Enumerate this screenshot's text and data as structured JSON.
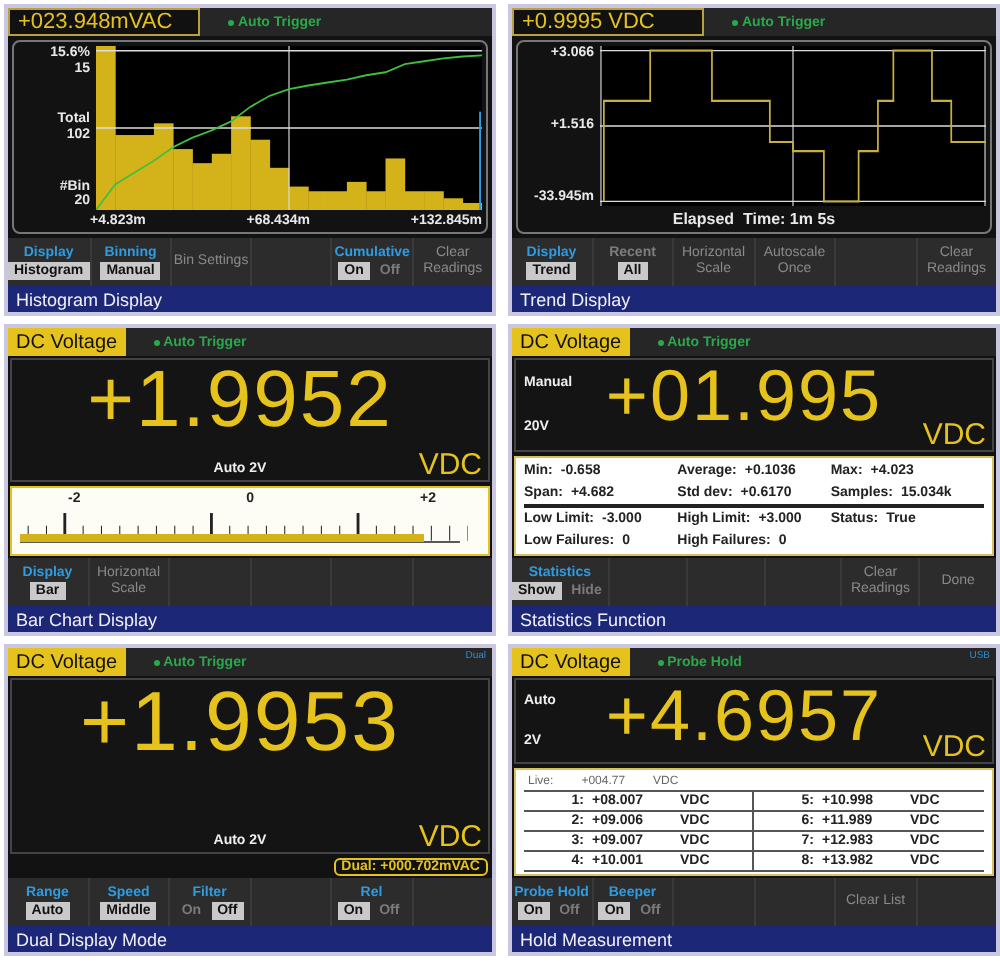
{
  "panels": [
    {
      "kind": "histogram",
      "header": {
        "kind": "reading",
        "label": "+023.948mVAC",
        "status": "Auto Trigger"
      },
      "histogram": {
        "y_labels": [
          [
            "15.6%",
            "15"
          ],
          [
            "Total",
            "102"
          ],
          [
            "#Bin",
            "20"
          ]
        ],
        "x_labels": [
          "+4.823m",
          "+68.434m",
          "+132.845m"
        ]
      },
      "softkeys": [
        {
          "kind": "toggle",
          "title": "Display",
          "disabled": false,
          "options": [
            {
              "label": "Histogram",
              "selected": true
            }
          ]
        },
        {
          "kind": "toggle",
          "title": "Binning",
          "disabled": false,
          "options": [
            {
              "label": "Manual",
              "selected": true
            }
          ]
        },
        {
          "kind": "action",
          "label": "Bin Settings"
        },
        {
          "kind": "empty"
        },
        {
          "kind": "toggle",
          "title": "Cumulative",
          "disabled": false,
          "options": [
            {
              "label": "On",
              "selected": true
            },
            {
              "label": "Off",
              "selected": false
            }
          ]
        },
        {
          "kind": "action",
          "label": "Clear Readings"
        }
      ],
      "caption": "Histogram Display"
    },
    {
      "kind": "trend",
      "header": {
        "kind": "reading",
        "label": "+0.9995 VDC",
        "status": "Auto Trigger"
      },
      "trend": {
        "y_labels": [
          "+3.066",
          "+1.516",
          "-33.945m"
        ],
        "elapsed": "Elapsed  Time: 1m 5s"
      },
      "softkeys": [
        {
          "kind": "toggle",
          "title": "Display",
          "disabled": false,
          "options": [
            {
              "label": "Trend",
              "selected": true
            }
          ]
        },
        {
          "kind": "toggle",
          "title": "Recent",
          "disabled": true,
          "options": [
            {
              "label": "All",
              "selected": true
            }
          ]
        },
        {
          "kind": "action",
          "label": "Horizontal Scale"
        },
        {
          "kind": "action",
          "label": "Autoscale Once"
        },
        {
          "kind": "empty"
        },
        {
          "kind": "action",
          "label": "Clear Readings"
        }
      ],
      "caption": "Trend Display"
    },
    {
      "kind": "bar",
      "header": {
        "kind": "function",
        "label": "DC Voltage",
        "status": "Auto Trigger"
      },
      "reading": {
        "value": "+1.9952",
        "unit": "VDC",
        "range": "Auto 2V"
      },
      "bar": {
        "scale": [
          "-2",
          "0",
          "+2"
        ],
        "level": 0.9
      },
      "softkeys": [
        {
          "kind": "toggle",
          "title": "Display",
          "disabled": false,
          "options": [
            {
              "label": "Bar",
              "selected": true
            }
          ]
        },
        {
          "kind": "action",
          "label": "Horizontal Scale"
        },
        {
          "kind": "empty"
        },
        {
          "kind": "empty"
        },
        {
          "kind": "empty"
        },
        {
          "kind": "empty"
        }
      ],
      "caption": "Bar Chart Display"
    },
    {
      "kind": "statistics",
      "header": {
        "kind": "function",
        "label": "DC Voltage",
        "status": "Auto Trigger"
      },
      "reading": {
        "value": "+01.995",
        "unit": "VDC",
        "range_side": [
          "Manual",
          "20V"
        ]
      },
      "stat_groups": [
        [
          [
            {
              "label": "Min:",
              "value": "-0.658"
            },
            {
              "label": "Average:",
              "value": "+0.1036"
            },
            {
              "label": "Max:",
              "value": "+4.023"
            }
          ],
          [
            {
              "label": "Span:",
              "value": "+4.682"
            },
            {
              "label": "Std dev:",
              "value": "+0.6170"
            },
            {
              "label": "Samples:",
              "value": "15.034k"
            }
          ]
        ],
        [
          [
            {
              "label": "Low Limit:",
              "value": "-3.000"
            },
            {
              "label": "High Limit:",
              "value": "+3.000"
            },
            {
              "label": "Status:",
              "value": "True"
            }
          ],
          [
            {
              "label": "Low Failures:",
              "value": "0"
            },
            {
              "label": "High Failures:",
              "value": "0"
            }
          ]
        ]
      ],
      "softkeys": [
        {
          "kind": "toggle",
          "title": "Statistics",
          "disabled": false,
          "options": [
            {
              "label": "Show",
              "selected": true
            },
            {
              "label": "Hide",
              "selected": false
            }
          ]
        },
        {
          "kind": "empty"
        },
        {
          "kind": "empty"
        },
        {
          "kind": "empty"
        },
        {
          "kind": "action",
          "label": "Clear Readings"
        },
        {
          "kind": "action",
          "label": "Done"
        }
      ],
      "caption": "Statistics Function"
    },
    {
      "kind": "dual",
      "header": {
        "kind": "function",
        "label": "DC Voltage",
        "status": "Auto Trigger",
        "corner": "Dual"
      },
      "reading": {
        "value": "+1.9953",
        "unit": "VDC",
        "range": "Auto 2V"
      },
      "dual": "Dual: +000.702mVAC",
      "softkeys": [
        {
          "kind": "toggle",
          "title": "Range",
          "disabled": false,
          "options": [
            {
              "label": "Auto",
              "selected": true
            }
          ]
        },
        {
          "kind": "toggle",
          "title": "Speed",
          "disabled": false,
          "options": [
            {
              "label": "Middle",
              "selected": true
            }
          ]
        },
        {
          "kind": "toggle",
          "title": "Filter",
          "disabled": false,
          "options": [
            {
              "label": "On",
              "selected": false
            },
            {
              "label": "Off",
              "selected": true
            }
          ]
        },
        {
          "kind": "empty"
        },
        {
          "kind": "toggle",
          "title": "Rel",
          "disabled": false,
          "options": [
            {
              "label": "On",
              "selected": true
            },
            {
              "label": "Off",
              "selected": false
            }
          ]
        },
        {
          "kind": "empty"
        }
      ],
      "caption": "Dual Display Mode"
    },
    {
      "kind": "hold",
      "header": {
        "kind": "function",
        "label": "DC Voltage",
        "status": "Probe Hold",
        "corner": "USB"
      },
      "reading": {
        "value": "+4.6957",
        "unit": "VDC",
        "range_side": [
          "Auto",
          "2V"
        ]
      },
      "live": {
        "label": "Live:",
        "value": "+004.77",
        "unit": "VDC"
      },
      "held": [
        {
          "index": "1:",
          "value": "+08.007",
          "unit": "VDC"
        },
        {
          "index": "2:",
          "value": "+09.006",
          "unit": "VDC"
        },
        {
          "index": "3:",
          "value": "+09.007",
          "unit": "VDC"
        },
        {
          "index": "4:",
          "value": "+10.001",
          "unit": "VDC"
        },
        {
          "index": "5:",
          "value": "+10.998",
          "unit": "VDC"
        },
        {
          "index": "6:",
          "value": "+11.989",
          "unit": "VDC"
        },
        {
          "index": "7:",
          "value": "+12.983",
          "unit": "VDC"
        },
        {
          "index": "8:",
          "value": "+13.982",
          "unit": "VDC"
        }
      ],
      "softkeys": [
        {
          "kind": "toggle",
          "title": "Probe Hold",
          "disabled": false,
          "options": [
            {
              "label": "On",
              "selected": true
            },
            {
              "label": "Off",
              "selected": false
            }
          ]
        },
        {
          "kind": "toggle",
          "title": "Beeper",
          "disabled": false,
          "options": [
            {
              "label": "On",
              "selected": true
            },
            {
              "label": "Off",
              "selected": false
            }
          ]
        },
        {
          "kind": "empty"
        },
        {
          "kind": "empty"
        },
        {
          "kind": "action",
          "label": "Clear List"
        },
        {
          "kind": "empty"
        }
      ],
      "caption": "Hold Measurement"
    }
  ]
}
